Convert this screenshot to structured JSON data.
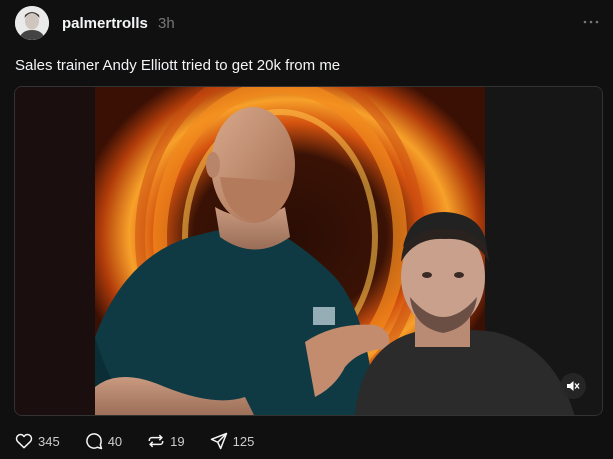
{
  "post": {
    "username": "palmertrolls",
    "timestamp": "3h",
    "caption": "Sales trainer Andy Elliott tried to get 20k from me"
  },
  "icons": {
    "more": "more-dots-icon",
    "mute": "speaker-muted-icon",
    "like": "heart-icon",
    "reply": "comment-icon",
    "repost": "repost-icon",
    "share": "send-icon"
  },
  "actions": {
    "likes": "345",
    "replies": "40",
    "reposts": "19",
    "shares": "125"
  },
  "colors": {
    "background": "#101010",
    "text": "#f3f5f7",
    "muted": "#777777"
  }
}
